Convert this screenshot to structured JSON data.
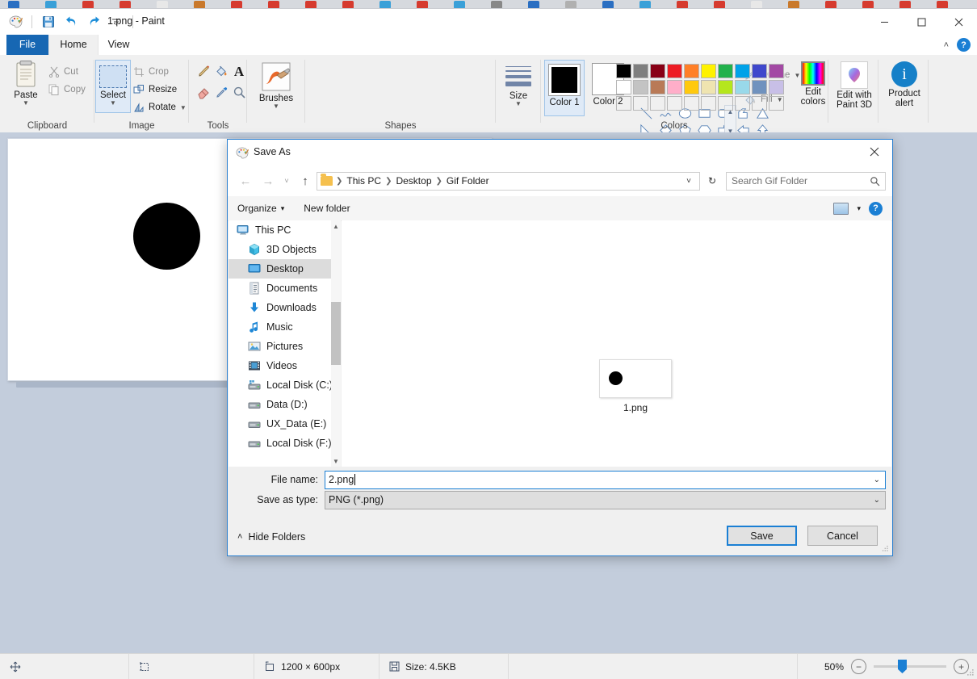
{
  "app": {
    "title": "1.png - Paint",
    "quick_access": [
      "paint-palette-icon",
      "save-icon",
      "undo-icon",
      "redo-icon",
      "customize-icon"
    ],
    "window_controls": {
      "minimize": "—",
      "maximize": "□",
      "close": "✕"
    },
    "ribbon_collapse": "˄",
    "help": "?"
  },
  "tabs": [
    {
      "label": "File",
      "active": false,
      "style": "file"
    },
    {
      "label": "Home",
      "active": true,
      "style": "home"
    },
    {
      "label": "View",
      "active": false,
      "style": "view"
    }
  ],
  "ribbon": {
    "clipboard": {
      "group_label": "Clipboard",
      "paste": "Paste",
      "cut": "Cut",
      "copy": "Copy"
    },
    "image": {
      "group_label": "Image",
      "select": "Select",
      "crop": "Crop",
      "resize": "Resize",
      "rotate": "Rotate"
    },
    "tools": {
      "group_label": "Tools",
      "icons": [
        "pencil-icon",
        "fill-bucket-icon",
        "text-icon",
        "eraser-icon",
        "color-picker-icon",
        "magnifier-icon"
      ]
    },
    "brushes": {
      "group_label": "",
      "label": "Brushes"
    },
    "shapes": {
      "group_label": "Shapes",
      "outline": "Outline",
      "fill": "Fill",
      "items": [
        "line",
        "curve",
        "oval",
        "rectangle",
        "rounded-rectangle",
        "polygon",
        "triangle",
        "right-triangle",
        "diamond",
        "pentagon",
        "hexagon",
        "arrow-right",
        "arrow-left",
        "arrow-up",
        "arrow-down",
        "four-point-star",
        "five-point-star",
        "six-point-star",
        "callout-rect",
        "callout-oval",
        "callout-cloud"
      ]
    },
    "size": {
      "group_label": "",
      "label": "Size"
    },
    "colors": {
      "group_label": "Colors",
      "color1_label": "Color 1",
      "color2_label": "Color 2",
      "color1_value": "#000000",
      "color2_value": "#ffffff",
      "edit_colors": "Edit colors",
      "edit_paint3d": "Edit with Paint 3D",
      "product_alert": "Product alert",
      "palette_row1": [
        "#000000",
        "#7f7f7f",
        "#880015",
        "#ed1c24",
        "#ff7f27",
        "#fff200",
        "#22b14c",
        "#00a2e8",
        "#3f48cc",
        "#a349a4"
      ],
      "palette_row2": [
        "#ffffff",
        "#c3c3c3",
        "#b97a57",
        "#ffaec9",
        "#ffc90e",
        "#efe4b0",
        "#b5e61d",
        "#99d9ea",
        "#7092be",
        "#c8bfe7"
      ],
      "palette_row3": [
        "",
        "",
        "",
        "",
        "",
        "",
        "",
        "",
        "",
        ""
      ]
    }
  },
  "canvas": {
    "shape": "black-circle"
  },
  "status_bar": {
    "position_icon": "cursor-position-icon",
    "selection_icon": "selection-size-icon",
    "image_size_icon": "image-size-icon",
    "image_size": "1200 × 600px",
    "file_size_icon": "file-size-icon",
    "file_size": "Size: 4.5KB",
    "zoom_level": "50%",
    "zoom_out": "−",
    "zoom_in": "+"
  },
  "dialog": {
    "title": "Save As",
    "title_icon": "paint-palette-icon",
    "close": "✕",
    "nav": {
      "back": "←",
      "forward": "→",
      "recent": "˅",
      "up": "↑",
      "breadcrumbs": [
        "This PC",
        "Desktop",
        "Gif Folder"
      ],
      "breadcrumb_caret": "˅",
      "refresh": "↻",
      "search_placeholder": "Search Gif Folder",
      "search_icon": "search-icon"
    },
    "toolbar": {
      "organize": "Organize",
      "organize_caret": "▾",
      "new_folder": "New folder",
      "view_icon": "view-layout-icon",
      "view_caret": "▾",
      "help": "?"
    },
    "places": [
      {
        "label": "This PC",
        "icon": "this-pc-icon",
        "selected": false,
        "indent": 0
      },
      {
        "label": "3D Objects",
        "icon": "3d-objects-icon",
        "selected": false,
        "indent": 1
      },
      {
        "label": "Desktop",
        "icon": "desktop-icon",
        "selected": true,
        "indent": 1
      },
      {
        "label": "Documents",
        "icon": "documents-icon",
        "selected": false,
        "indent": 1
      },
      {
        "label": "Downloads",
        "icon": "downloads-icon",
        "selected": false,
        "indent": 1
      },
      {
        "label": "Music",
        "icon": "music-icon",
        "selected": false,
        "indent": 1
      },
      {
        "label": "Pictures",
        "icon": "pictures-icon",
        "selected": false,
        "indent": 1
      },
      {
        "label": "Videos",
        "icon": "videos-icon",
        "selected": false,
        "indent": 1
      },
      {
        "label": "Local Disk (C:)",
        "icon": "system-drive-icon",
        "selected": false,
        "indent": 1
      },
      {
        "label": "Data (D:)",
        "icon": "drive-icon",
        "selected": false,
        "indent": 1
      },
      {
        "label": "UX_Data (E:)",
        "icon": "drive-icon",
        "selected": false,
        "indent": 1
      },
      {
        "label": "Local Disk (F:)",
        "icon": "drive-icon",
        "selected": false,
        "indent": 1
      }
    ],
    "files": [
      {
        "name": "1.png",
        "thumb": "black-dot-thumbnail"
      }
    ],
    "file_name_label": "File name:",
    "file_name_value": "2.png",
    "save_type_label": "Save as type:",
    "save_type_value": "PNG (*.png)",
    "hide_folders": "Hide Folders",
    "hide_folders_caret": "˄",
    "save_button": "Save",
    "cancel_button": "Cancel"
  }
}
